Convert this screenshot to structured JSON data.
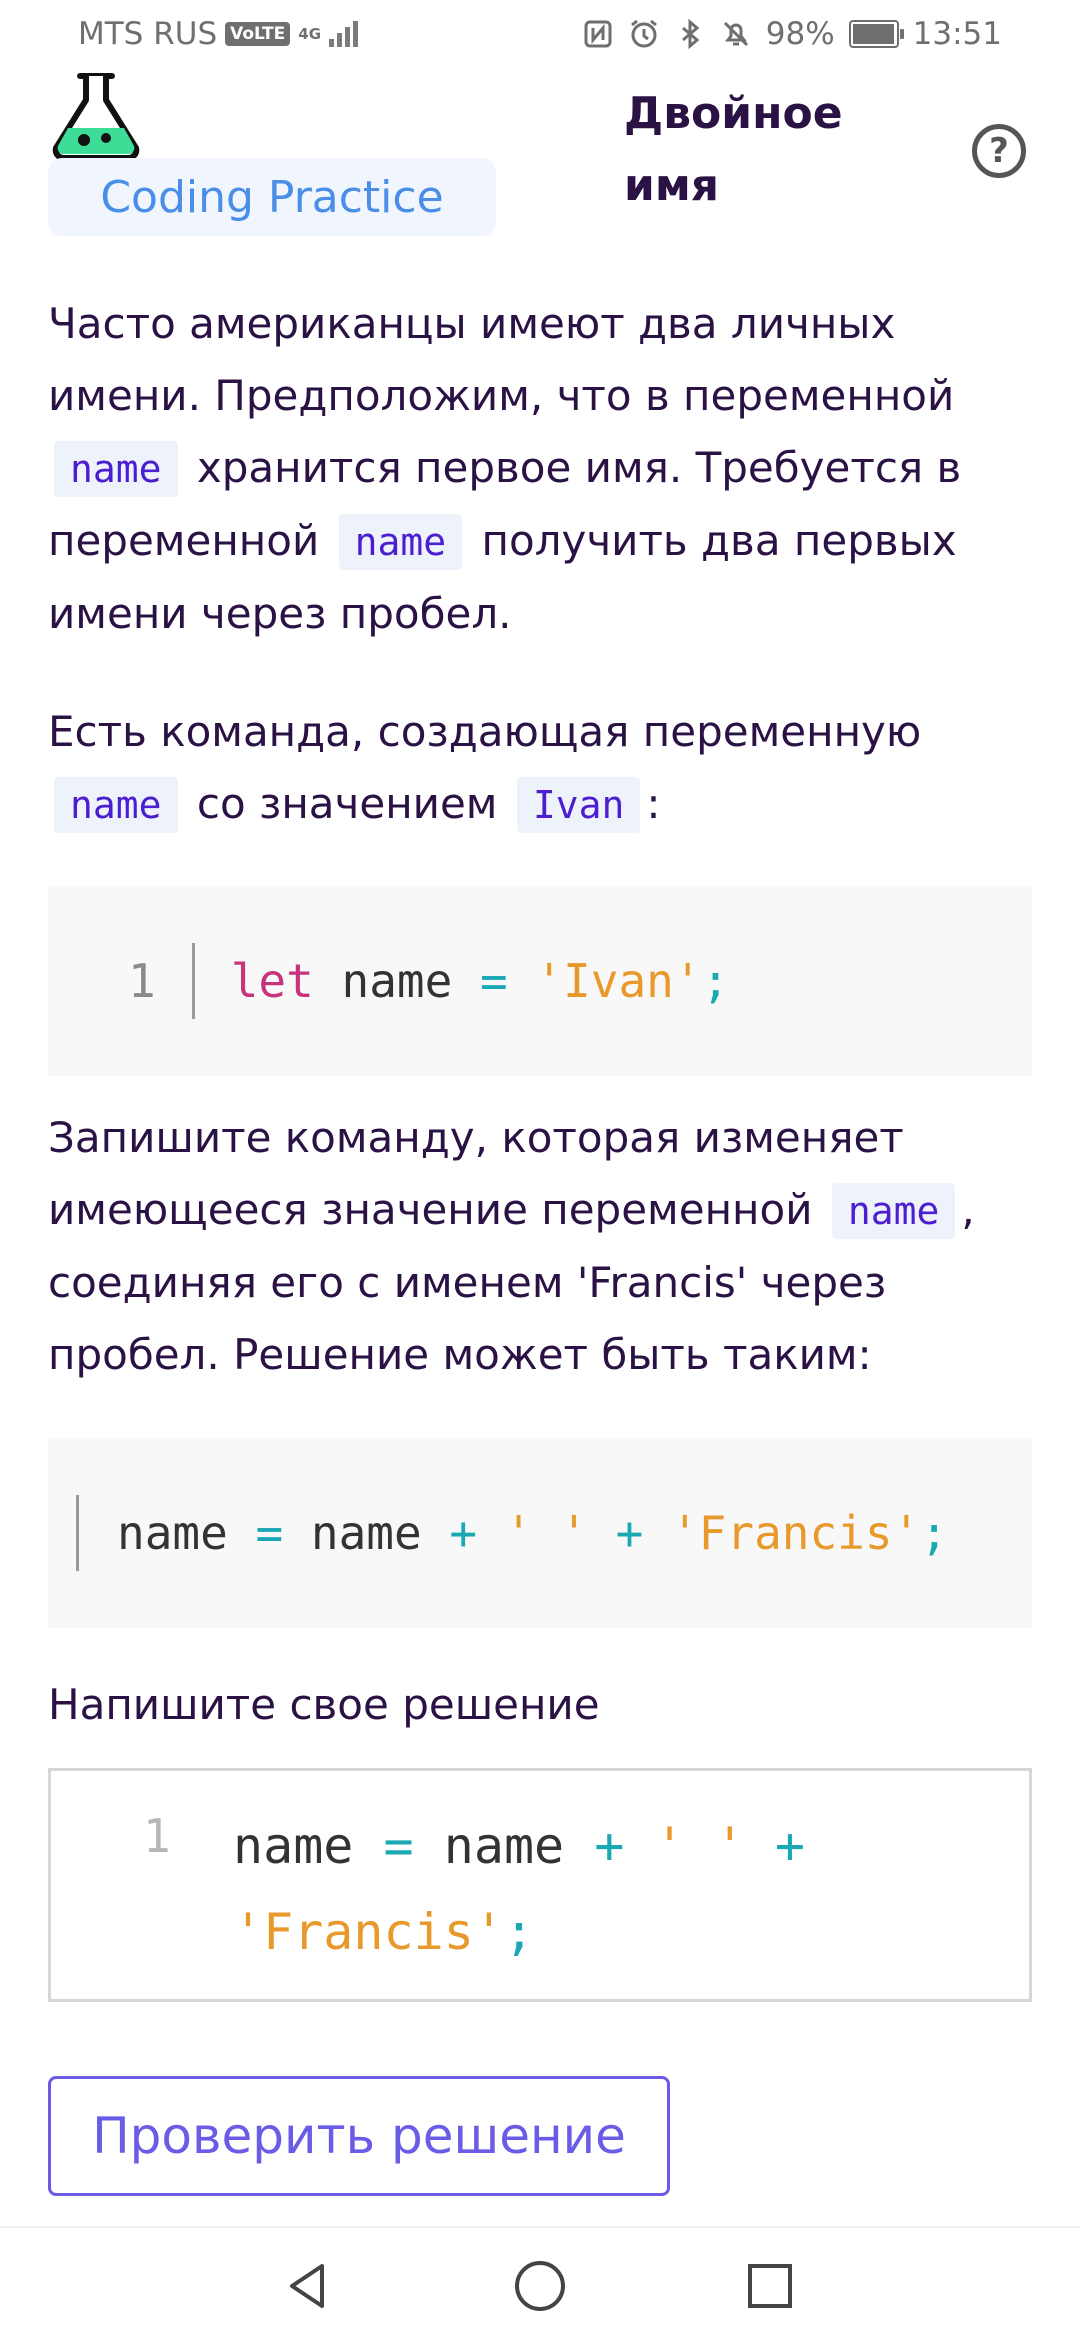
{
  "status": {
    "carrier": "MTS RUS",
    "volte": "VoLTE",
    "network": "4G",
    "battery": "98%",
    "time": "13:51",
    "icons": [
      "nfc-icon",
      "alarm-icon",
      "bluetooth-icon",
      "mute-icon"
    ]
  },
  "header": {
    "badge": "Coding Practice",
    "title": "Двойное имя",
    "help": "?"
  },
  "task": {
    "p1_a": "Часто американцы имеют два личных имени. Предположим, что в переменной",
    "p1_b": "хранится первое имя. Требуется в переменной",
    "p1_c": "получить два первых имени через пробел.",
    "p2_a": "Есть команда, создающая переменную",
    "p2_b": "со значением",
    "p2_c": ":",
    "p3_a": "Запишите команду, которая изменяет имеющееся значение переменной",
    "p3_b": ", соединяя его с именем 'Francis' через пробел. Решение может быть таким:",
    "var": "name",
    "value": "Ivan"
  },
  "code1": {
    "line_no": "1",
    "tokens": [
      "let",
      "name",
      "=",
      "'Ivan'",
      ";"
    ]
  },
  "code2": {
    "tokens": [
      "name",
      "=",
      "name",
      "+",
      "' '",
      "+",
      "'Francis'",
      ";"
    ]
  },
  "solution": {
    "label": "Напишите свое решение",
    "line_no": "1",
    "tokens": [
      "name",
      "=",
      "name",
      "+",
      "' '",
      "+",
      "'Francis'",
      ";"
    ]
  },
  "check_button": "Проверить решение"
}
